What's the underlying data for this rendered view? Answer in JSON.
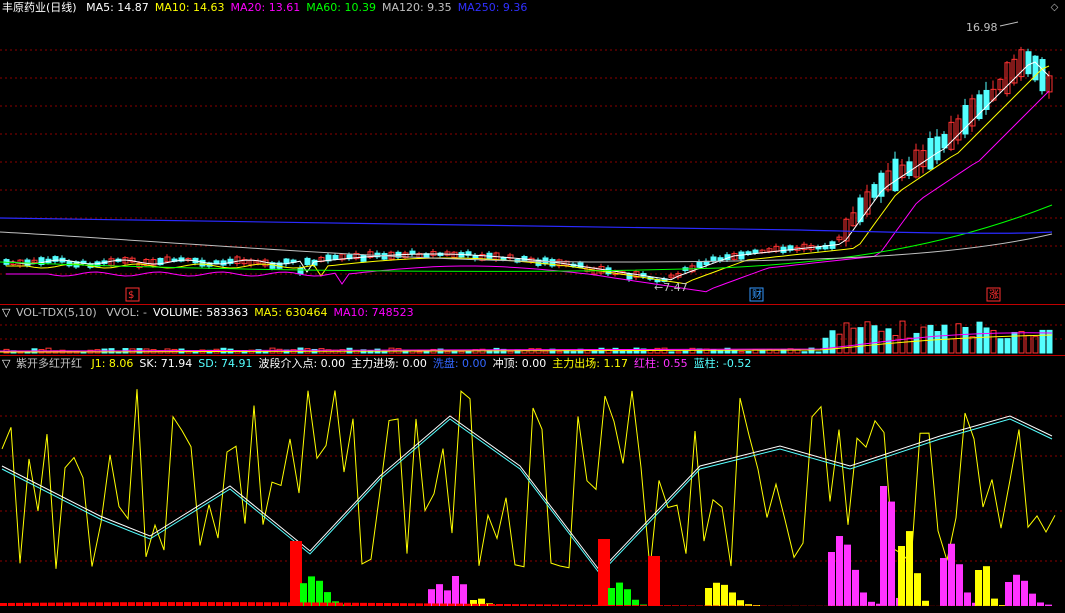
{
  "main": {
    "title": "丰原药业(日线)",
    "ma": [
      {
        "label": "MA5: 14.87",
        "color": "#ffffff"
      },
      {
        "label": "MA10: 14.63",
        "color": "#ffff00"
      },
      {
        "label": "MA20: 13.61",
        "color": "#ff00ff"
      },
      {
        "label": "MA60: 10.39",
        "color": "#00ff00"
      },
      {
        "label": "MA120: 9.35",
        "color": "#c0c0c0"
      },
      {
        "label": "MA250: 9.36",
        "color": "#3030ff"
      }
    ],
    "high_label": "16.98",
    "low_label": "7.47",
    "markers": [
      {
        "text": "$",
        "color": "#ff3030"
      },
      {
        "text": "财",
        "color": "#3399ff"
      },
      {
        "text": "涨",
        "color": "#ff3030"
      }
    ],
    "colors": {
      "up": "#ff3232",
      "down": "#54ffff",
      "grid": "#8b0000"
    }
  },
  "vol": {
    "title": "VOL-TDX(5,10)",
    "items": [
      {
        "label": "VVOL: -",
        "color": "#c0c0c0"
      },
      {
        "label": "VOLUME: 583363",
        "color": "#ffffff"
      },
      {
        "label": "MA5: 630464",
        "color": "#ffff00"
      },
      {
        "label": "MA10: 748523",
        "color": "#ff00ff"
      }
    ]
  },
  "ind": {
    "title": "紫开多红开红",
    "items": [
      {
        "label": "J1: 8.06",
        "color": "#ffff00"
      },
      {
        "label": "SK: 71.94",
        "color": "#ffffff"
      },
      {
        "label": "SD: 74.91",
        "color": "#54ffff"
      },
      {
        "label": "波段介入点: 0.00",
        "color": "#ffffff"
      },
      {
        "label": "主力进场: 0.00",
        "color": "#ffffff"
      },
      {
        "label": "洗盘: 0.00",
        "color": "#3366ff"
      },
      {
        "label": "冲顶: 0.00",
        "color": "#ffffff"
      },
      {
        "label": "主力出场: 1.17",
        "color": "#ffff00"
      },
      {
        "label": "红柱: 0.55",
        "color": "#ff33ff"
      },
      {
        "label": "蓝柱: -0.52",
        "color": "#54ffff"
      }
    ]
  }
}
